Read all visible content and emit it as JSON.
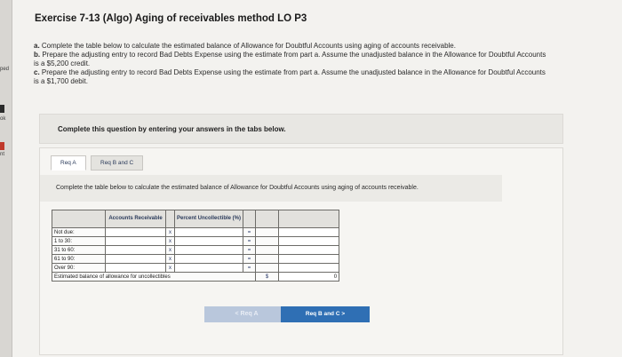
{
  "sidebar": {
    "labels": [
      "ped",
      "ok",
      "nt"
    ]
  },
  "exercise": {
    "title": "Exercise 7-13 (Algo) Aging of receivables method LO P3",
    "part_a_prefix": "a.",
    "part_a": "Complete the table below to calculate the estimated balance of Allowance for Doubtful Accounts using aging of accounts receivable.",
    "part_b_prefix": "b.",
    "part_b": "Prepare the adjusting entry to record Bad Debts Expense using the estimate from part a. Assume the unadjusted balance in the Allowance for Doubtful Accounts is a $5,200 credit.",
    "part_c_prefix": "c.",
    "part_c": "Prepare the adjusting entry to record Bad Debts Expense using the estimate from part a. Assume the unadjusted balance in the Allowance for Doubtful Accounts is a $1,700 debit."
  },
  "instruction": "Complete this question by entering your answers in the tabs below.",
  "tabs": [
    {
      "label": "Req A"
    },
    {
      "label": "Req B and C"
    }
  ],
  "tab_instruction": "Complete the table below to calculate the estimated balance of Allowance for Doubtful Accounts using aging of accounts receivable.",
  "table": {
    "header_ar": "Accounts Receivable",
    "header_pct": "Percent Uncollectible (%)",
    "multiply": "x",
    "equals": "=",
    "rows": [
      {
        "label": "Not due:"
      },
      {
        "label": "1 to 30:"
      },
      {
        "label": "31 to 60:"
      },
      {
        "label": "61 to 90:"
      },
      {
        "label": "Over 90:"
      }
    ],
    "total_label": "Estimated balance of allowance for uncollectibles",
    "currency": "$",
    "total_value": "0"
  },
  "nav": {
    "prev_label": "< Req A",
    "next_label": "Req B and C  >"
  }
}
